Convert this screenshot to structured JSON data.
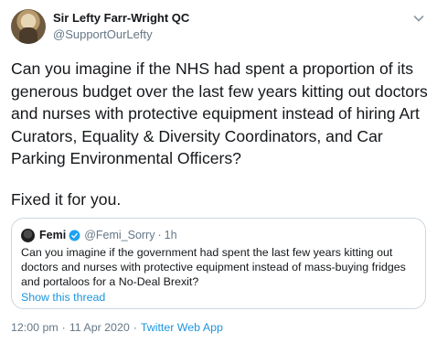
{
  "author": {
    "display_name": "Sir Lefty Farr-Wright QC",
    "handle": "@SupportOurLefty"
  },
  "tweet": {
    "text": "Can you imagine if the NHS had spent a proportion of its generous budget over the last few years kitting out doctors and nurses with protective equipment instead of hiring Art Curators, Equality & Diversity Coordinators, and Car Parking Environmental Officers?",
    "addendum": "Fixed it for you."
  },
  "quote": {
    "display_name": "Femi",
    "handle": "@Femi_Sorry",
    "separator": "·",
    "age": "1h",
    "text": "Can you imagine if the government had spent the last few years kitting out doctors and nurses with protective equipment instead of mass-buying fridges and portaloos for a No-Deal Brexit?",
    "show_thread": "Show this thread"
  },
  "meta": {
    "time": "12:00 pm",
    "separator": "·",
    "date": "11 Apr 2020",
    "source": "Twitter Web App"
  },
  "icons": {
    "caret": "chevron-down-icon",
    "verified": "verified-badge-icon"
  },
  "colors": {
    "accent": "#1b95e0",
    "muted": "#657786",
    "border": "#ccd6dd"
  }
}
